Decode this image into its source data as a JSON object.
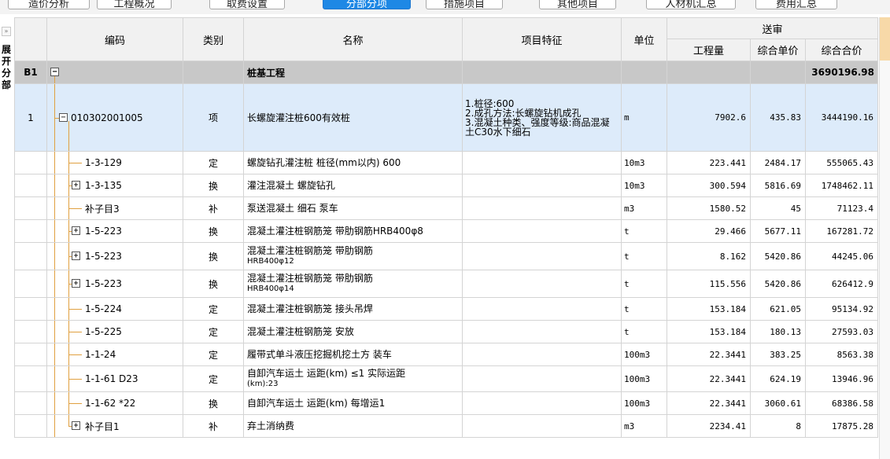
{
  "tabs": [
    {
      "label": "造价分析",
      "active": false
    },
    {
      "label": "工程概况",
      "active": false
    },
    {
      "label": "取费设置",
      "active": false
    },
    {
      "label": "分部分项",
      "active": true
    },
    {
      "label": "措施项目",
      "active": false
    },
    {
      "label": "其他项目",
      "active": false
    },
    {
      "label": "人材机汇总",
      "active": false
    },
    {
      "label": "费用汇总",
      "active": false
    }
  ],
  "side_panel": {
    "expand_icon": "»",
    "label": "展开分部"
  },
  "columns": {
    "code": "编码",
    "category": "类别",
    "name": "名称",
    "features": "项目特征",
    "unit": "单位",
    "group": "送审",
    "quantity": "工程量",
    "unit_price": "综合单价",
    "total": "综合合价"
  },
  "section": {
    "index": "B1",
    "toggle": "−",
    "name": "桩基工程",
    "total": "3690196.98"
  },
  "item": {
    "index": "1",
    "toggle": "−",
    "code": "010302001005",
    "category": "项",
    "name": "长螺旋灌注桩600有效桩",
    "features": [
      "1.桩径:600",
      "2.成孔方法:长螺旋钻机成孔",
      "3.混凝土种类、强度等级:商品混凝土C30水下细石"
    ],
    "unit": "m",
    "quantity": "7902.6",
    "unit_price": "435.83",
    "total": "3444190.16"
  },
  "rows": [
    {
      "toggle": "",
      "code": "1-3-129",
      "category": "定",
      "name": "螺旋钻孔灌注桩 桩径(mm以内) 600",
      "unit": "10m3",
      "quantity": "223.441",
      "unit_price": "2484.17",
      "total": "555065.43"
    },
    {
      "toggle": "+",
      "code": "1-3-135",
      "category": "换",
      "name": "灌注混凝土 螺旋钻孔",
      "unit": "10m3",
      "quantity": "300.594",
      "unit_price": "5816.69",
      "total": "1748462.11"
    },
    {
      "toggle": "",
      "code": "补子目3",
      "category": "补",
      "name": "泵送混凝土 细石 泵车",
      "unit": "m3",
      "quantity": "1580.52",
      "unit_price": "45",
      "total": "71123.4"
    },
    {
      "toggle": "+",
      "code": "1-5-223",
      "category": "换",
      "name": "混凝土灌注桩钢筋笼 带肋钢筋HRB400φ8",
      "unit": "t",
      "quantity": "29.466",
      "unit_price": "5677.11",
      "total": "167281.72"
    },
    {
      "toggle": "+",
      "code": "1-5-223",
      "category": "换",
      "name": "混凝土灌注桩钢筋笼 带肋钢筋",
      "name2": "HRB400φ12",
      "unit": "t",
      "quantity": "8.162",
      "unit_price": "5420.86",
      "total": "44245.06"
    },
    {
      "toggle": "+",
      "code": "1-5-223",
      "category": "换",
      "name": "混凝土灌注桩钢筋笼 带肋钢筋",
      "name2": "HRB400φ14",
      "unit": "t",
      "quantity": "115.556",
      "unit_price": "5420.86",
      "total": "626412.9"
    },
    {
      "toggle": "",
      "code": "1-5-224",
      "category": "定",
      "name": "混凝土灌注桩钢筋笼 接头吊焊",
      "unit": "t",
      "quantity": "153.184",
      "unit_price": "621.05",
      "total": "95134.92"
    },
    {
      "toggle": "",
      "code": "1-5-225",
      "category": "定",
      "name": "混凝土灌注桩钢筋笼 安放",
      "unit": "t",
      "quantity": "153.184",
      "unit_price": "180.13",
      "total": "27593.03"
    },
    {
      "toggle": "",
      "code": "1-1-24",
      "category": "定",
      "name": "履带式单斗液压挖掘机挖土方 装车",
      "unit": "100m3",
      "quantity": "22.3441",
      "unit_price": "383.25",
      "total": "8563.38"
    },
    {
      "toggle": "",
      "code": "1-1-61 D23",
      "category": "定",
      "name": "自卸汽车运土 运距(km) ≤1  实际运距",
      "name2": "(km):23",
      "unit": "100m3",
      "quantity": "22.3441",
      "unit_price": "624.19",
      "total": "13946.96"
    },
    {
      "toggle": "",
      "code": "1-1-62 *22",
      "category": "换",
      "name": "自卸汽车运土 运距(km) 每增运1",
      "unit": "100m3",
      "quantity": "22.3441",
      "unit_price": "3060.61",
      "total": "68386.58"
    },
    {
      "toggle": "+",
      "code": "补子目1",
      "category": "补",
      "name": "弃土消纳费",
      "unit": "m3",
      "quantity": "2234.41",
      "unit_price": "8",
      "total": "17875.28"
    }
  ]
}
